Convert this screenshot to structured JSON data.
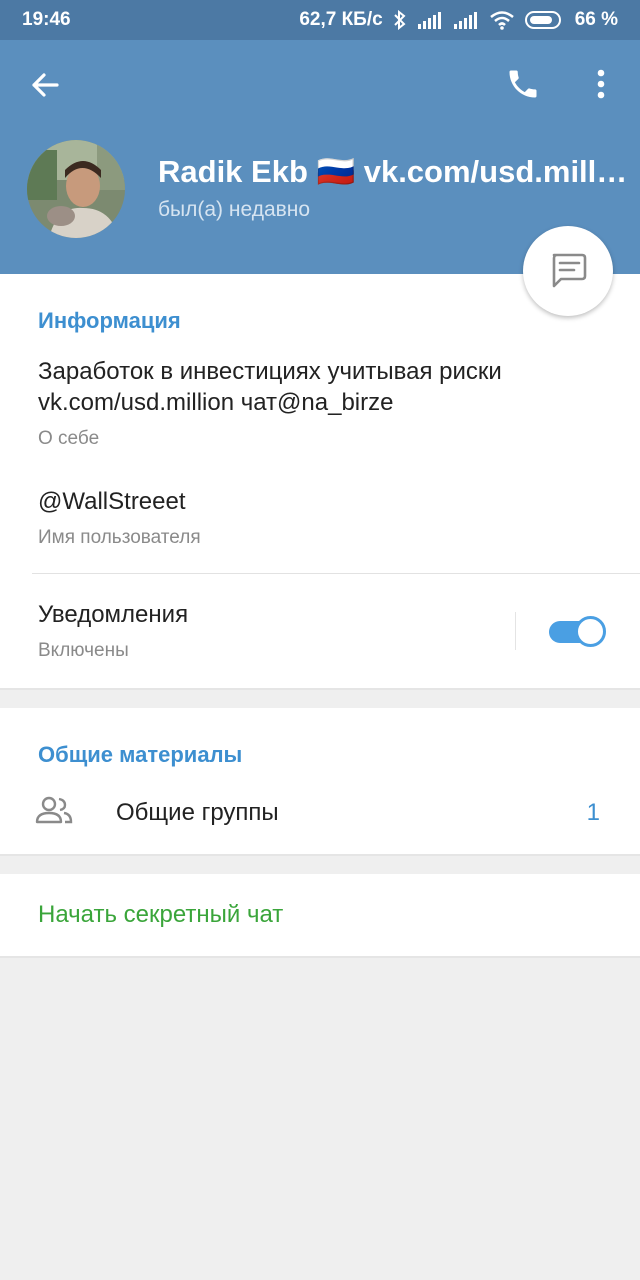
{
  "status_bar": {
    "time": "19:46",
    "speed": "62,7 КБ/с",
    "battery": "66 %"
  },
  "header": {
    "name": "Radik Ekb 🇷🇺 vk.com/usd.million",
    "status": "был(а) недавно"
  },
  "info": {
    "title": "Информация",
    "about_line1": "Заработок в инвестициях учитывая риски",
    "about_line2": "vk.com/usd.million чат@na_birze",
    "about_label": "О себе",
    "username": "@WallStreeet",
    "username_label": "Имя пользователя",
    "notifications": "Уведомления",
    "notifications_state": "Включены",
    "notifications_on": true
  },
  "shared": {
    "title": "Общие материалы",
    "groups_label": "Общие группы",
    "groups_count": "1"
  },
  "secret": {
    "label": "Начать секретный чат"
  },
  "colors": {
    "header": "#5b8fbe",
    "statusbar": "#4c79a4",
    "accent": "#3d8fd0",
    "secret": "#3aa53a"
  }
}
